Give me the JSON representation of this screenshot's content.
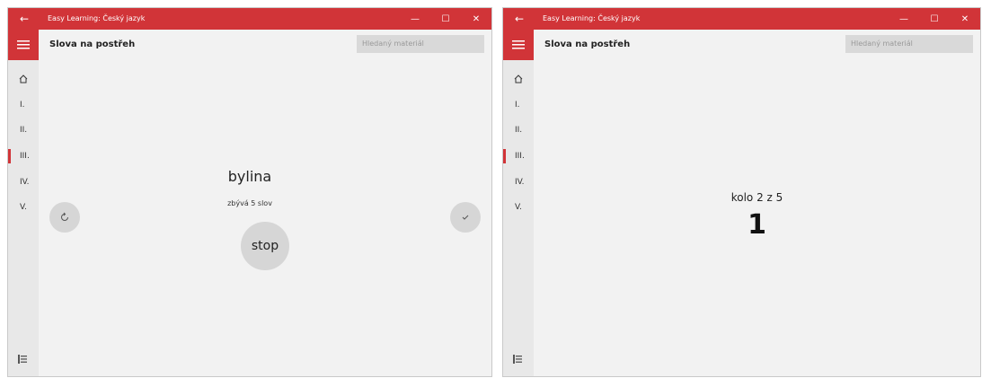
{
  "windows": [
    {
      "title": "Easy Learning: Český jazyk",
      "page_title": "Slova na postřeh",
      "search_placeholder": "Hledaný materiál",
      "nav": [
        {
          "label": "I."
        },
        {
          "label": "II."
        },
        {
          "label": "III.",
          "active": true
        },
        {
          "label": "IV."
        },
        {
          "label": "V."
        }
      ],
      "word": "bylina",
      "remaining": "zbývá 5 slov",
      "stop_label": "stop"
    },
    {
      "title": "Easy Learning: Český jazyk",
      "page_title": "Slova na postřeh",
      "search_placeholder": "Hledaný materiál",
      "nav": [
        {
          "label": "I."
        },
        {
          "label": "II."
        },
        {
          "label": "III.",
          "active": true
        },
        {
          "label": "IV."
        },
        {
          "label": "V."
        }
      ],
      "round_label": "kolo 2 z 5",
      "round_number": "1"
    }
  ],
  "icons": [
    "back-arrow-icon",
    "minimize-icon",
    "maximize-icon",
    "close-icon",
    "hamburger-icon",
    "home-icon",
    "reset-icon",
    "check-icon",
    "sidebar-toggle-icon"
  ],
  "colors": {
    "accent": "#d13438",
    "background": "#f2f2f2",
    "button": "#d6d6d6"
  }
}
